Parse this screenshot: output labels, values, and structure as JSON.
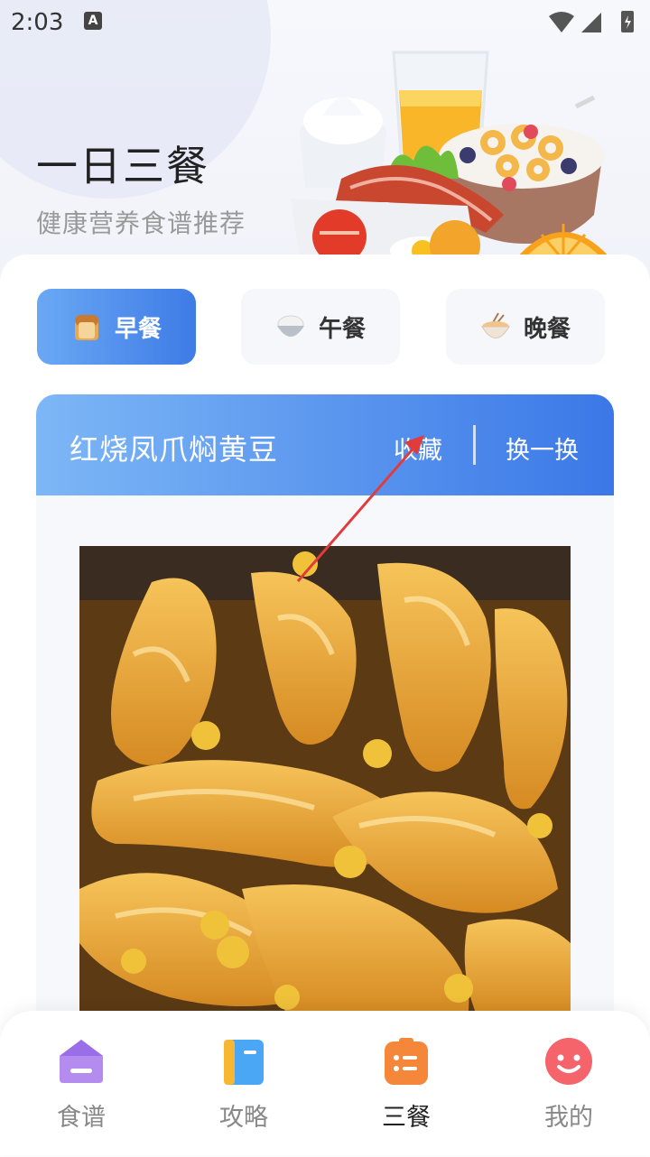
{
  "status_bar": {
    "time": "2:03",
    "notification_glyph": "A"
  },
  "hero": {
    "title": "一日三餐",
    "subtitle": "健康营养食谱推荐"
  },
  "meal_tabs": [
    {
      "label": "早餐",
      "icon": "bread-icon",
      "active": true
    },
    {
      "label": "午餐",
      "icon": "rice-bowl-icon",
      "active": false
    },
    {
      "label": "晚餐",
      "icon": "noodle-bowl-icon",
      "active": false
    }
  ],
  "recipe": {
    "name": "红烧凤爪焖黄豆",
    "favorite_label": "收藏",
    "change_label": "换一换"
  },
  "bottom_nav": [
    {
      "label": "食谱",
      "icon": "home-icon",
      "active": false
    },
    {
      "label": "攻略",
      "icon": "book-icon",
      "active": false
    },
    {
      "label": "三餐",
      "icon": "list-icon",
      "active": true
    },
    {
      "label": "我的",
      "icon": "smile-icon",
      "active": false
    }
  ],
  "colors": {
    "accent_blue": "#3b78e7",
    "active_tab_start": "#6aa8f5",
    "nav_active_orange": "#f5873a",
    "annotation_red": "#e23b3b"
  }
}
